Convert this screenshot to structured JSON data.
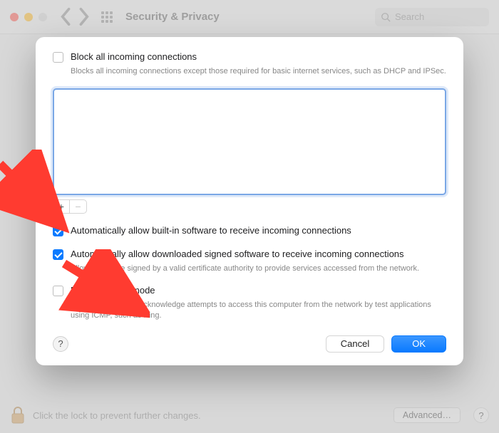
{
  "titlebar": {
    "title": "Security & Privacy",
    "search_placeholder": "Search"
  },
  "bottom": {
    "lock_text": "Click the lock to prevent further changes.",
    "advanced_label": "Advanced…"
  },
  "sheet": {
    "block_all": {
      "label": "Block all incoming connections",
      "sub": "Blocks all incoming connections except those required for basic internet services, such as DHCP and IPSec.",
      "checked": false
    },
    "auto_builtin": {
      "label": "Automatically allow built-in software to receive incoming connections",
      "checked": true
    },
    "auto_downloaded": {
      "label": "Automatically allow downloaded signed software to receive incoming connections",
      "sub": "Allows software signed by a valid certificate authority to provide services accessed from the network.",
      "checked": true
    },
    "stealth": {
      "label": "Enable stealth mode",
      "sub": "Don't respond to or acknowledge attempts to access this computer from the network by test applications using ICMP, such as Ping.",
      "checked": false
    },
    "buttons": {
      "cancel": "Cancel",
      "ok": "OK"
    },
    "add_label": "+",
    "remove_label": "−"
  }
}
